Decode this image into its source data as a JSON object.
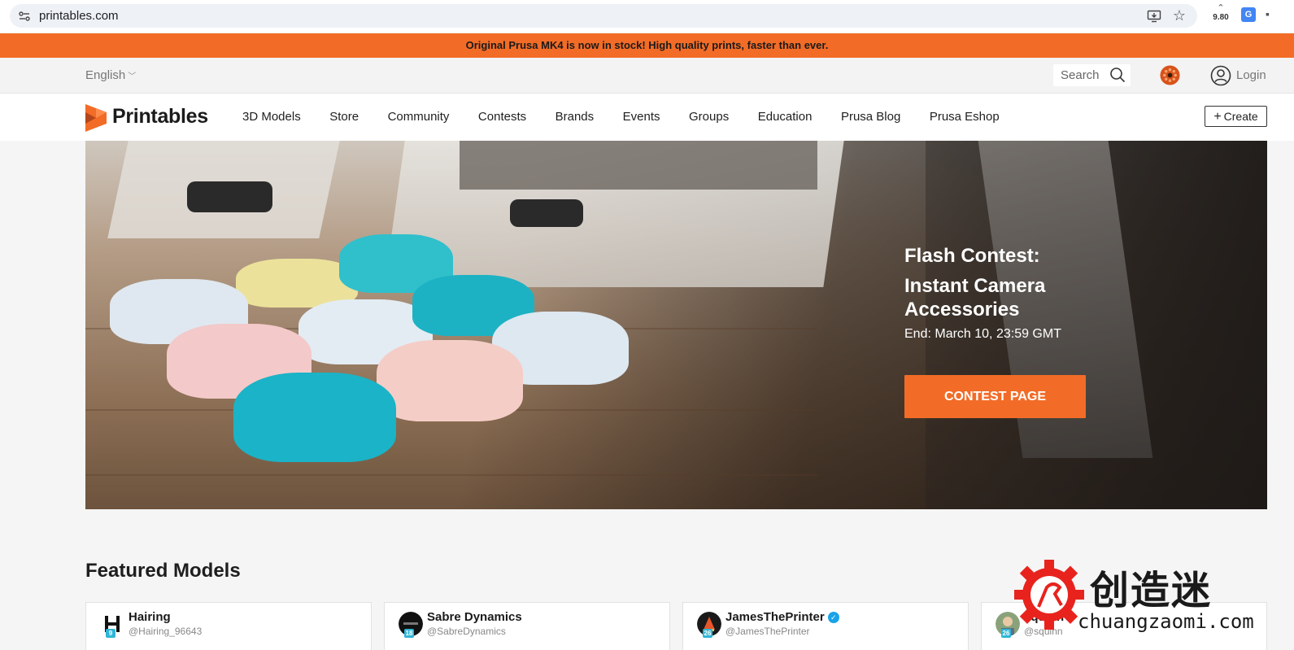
{
  "browser": {
    "url": "printables.com",
    "ext_counter": "9.80"
  },
  "banner": {
    "text": "Original Prusa MK4 is now in stock! High quality prints, faster than ever."
  },
  "utility_bar": {
    "language": "English",
    "search_placeholder": "Search",
    "login_label": "Login"
  },
  "nav": {
    "brand": "Printables",
    "links": [
      "3D Models",
      "Store",
      "Community",
      "Contests",
      "Brands",
      "Events",
      "Groups",
      "Education",
      "Prusa Blog",
      "Prusa Eshop"
    ],
    "create_label": "Create"
  },
  "hero": {
    "title_line1": "Flash Contest:",
    "title_line2": "Instant Camera Accessories",
    "end_date": "End: March 10, 23:59 GMT",
    "cta_label": "CONTEST PAGE"
  },
  "featured": {
    "title": "Featured Models",
    "cards": [
      {
        "name": "Hairing",
        "handle": "@Hairing_96643",
        "level": "9",
        "verified": false
      },
      {
        "name": "Sabre Dynamics",
        "handle": "@SabreDynamics",
        "level": "18",
        "verified": false
      },
      {
        "name": "JamesThePrinter",
        "handle": "@JamesThePrinter",
        "level": "26",
        "verified": true
      },
      {
        "name": "squinn",
        "handle": "@squinn",
        "level": "26",
        "verified": false
      }
    ]
  },
  "watermark": {
    "cn_text": "创造迷",
    "url_text": "chuangzaomi.com"
  },
  "colors": {
    "accent": "#f26c27",
    "level_badge": "#2fb5d6",
    "verified": "#1aa3e8",
    "watermark_red": "#e8231d"
  }
}
